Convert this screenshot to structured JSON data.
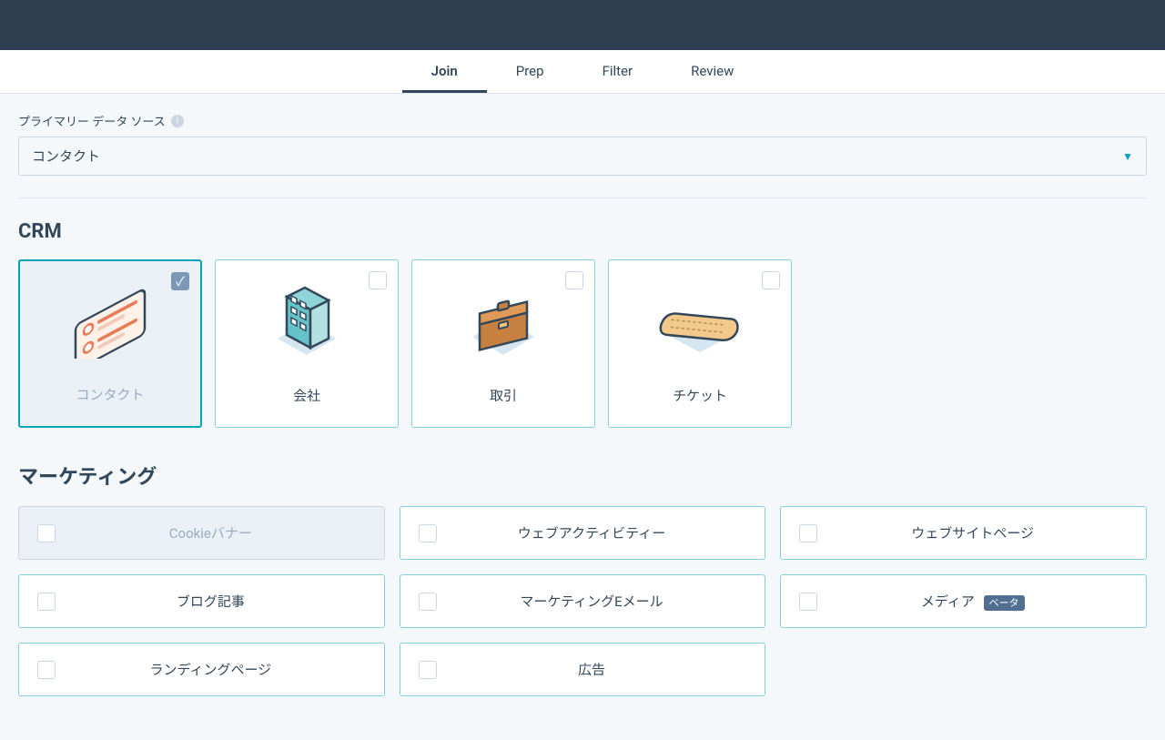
{
  "tabs": {
    "join": "Join",
    "prep": "Prep",
    "filter": "Filter",
    "review": "Review",
    "active": "join"
  },
  "primary": {
    "label": "プライマリー データ ソース",
    "value": "コンタクト"
  },
  "crm": {
    "title": "CRM",
    "items": {
      "contacts": "コンタクト",
      "companies": "会社",
      "deals": "取引",
      "tickets": "チケット"
    }
  },
  "marketing": {
    "title": "マーケティング",
    "items": {
      "cookie_banner": "Cookieバナー",
      "web_activity": "ウェブアクティビティー",
      "website_page": "ウェブサイトページ",
      "blog_post": "ブログ記事",
      "marketing_email": "マーケティングEメール",
      "media": "メディア",
      "landing_page": "ランディングページ",
      "ads": "広告"
    },
    "beta_label": "ベータ"
  }
}
